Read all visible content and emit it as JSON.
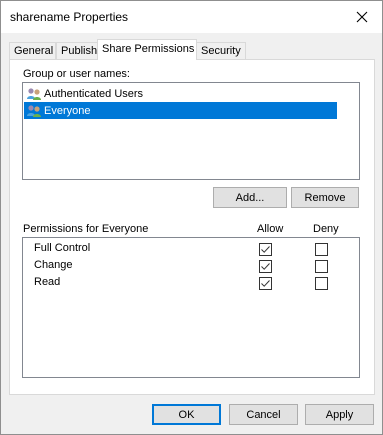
{
  "window": {
    "title": "sharename Properties"
  },
  "tabs": [
    {
      "label": "General",
      "active": false
    },
    {
      "label": "Publish",
      "active": false
    },
    {
      "label": "Share Permissions",
      "active": true
    },
    {
      "label": "Security",
      "active": false
    }
  ],
  "groups": {
    "label": "Group or user names:",
    "items": [
      {
        "name": "Authenticated Users",
        "icon": "users-icon",
        "selected": false
      },
      {
        "name": "Everyone",
        "icon": "users-icon",
        "selected": true
      }
    ]
  },
  "buttons": {
    "add": "Add...",
    "remove": "Remove",
    "ok": "OK",
    "cancel": "Cancel",
    "apply": "Apply"
  },
  "permissions": {
    "label": "Permissions for Everyone",
    "allow_header": "Allow",
    "deny_header": "Deny",
    "rows": [
      {
        "name": "Full Control",
        "allow": true,
        "deny": false
      },
      {
        "name": "Change",
        "allow": true,
        "deny": false
      },
      {
        "name": "Read",
        "allow": true,
        "deny": false
      }
    ]
  },
  "colors": {
    "selection": "#0078d7",
    "default_button_border": "#0078d7"
  }
}
